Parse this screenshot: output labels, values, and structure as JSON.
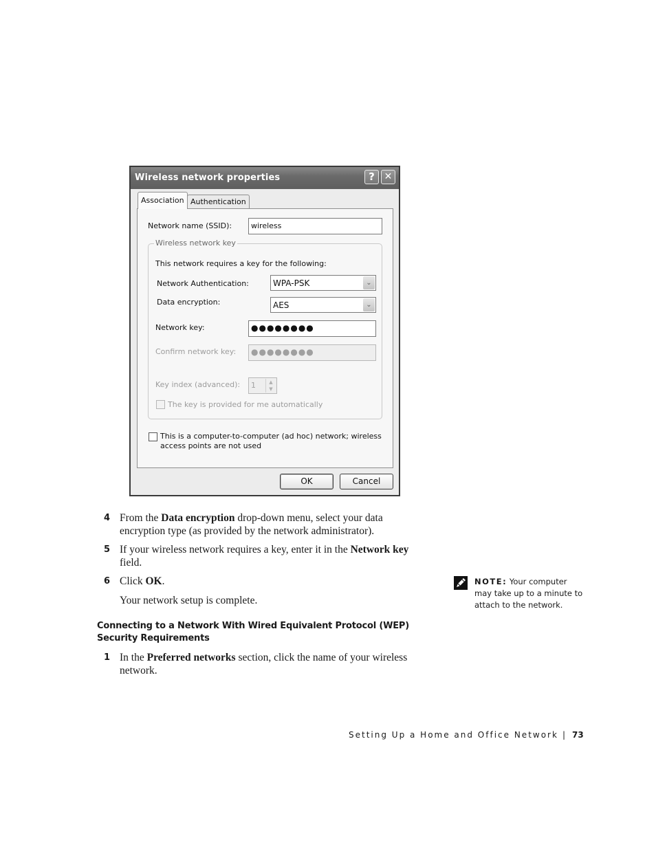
{
  "dialog": {
    "title": "Wireless network properties",
    "help_button": "?",
    "close_button": "✕",
    "tabs": [
      {
        "label": "Association",
        "active": true
      },
      {
        "label": "Authentication",
        "active": false
      }
    ],
    "ssid": {
      "label": "Network name (SSID):",
      "value": "wireless"
    },
    "key_group": {
      "legend": "Wireless network key",
      "intro": "This network requires a key for the following:",
      "network_auth": {
        "label": "Network Authentication:",
        "value": "WPA-PSK"
      },
      "data_encryption": {
        "label": "Data encryption:",
        "value": "AES"
      },
      "network_key": {
        "label": "Network key:",
        "value": "●●●●●●●●"
      },
      "confirm_key": {
        "label": "Confirm network key:",
        "value": "●●●●●●●●",
        "disabled": true
      },
      "key_index": {
        "label": "Key index (advanced):",
        "value": "1",
        "disabled": true
      },
      "auto_key": {
        "label": "The key is provided for me automatically",
        "checked": false,
        "disabled": true
      }
    },
    "adhoc": {
      "line1": "This is a computer-to-computer (ad hoc) network; wireless",
      "line2": "access points are not used",
      "checked": false
    },
    "ok_label": "OK",
    "cancel_label": "Cancel"
  },
  "steps": [
    {
      "num": "4",
      "pre": "From the ",
      "bold": "Data encryption",
      "post": " drop-down menu, select your data encryption type (as provided by the network administrator)."
    },
    {
      "num": "5",
      "pre": "If your wireless network requires a key, enter it in the ",
      "bold": "Network key",
      "post": " field."
    },
    {
      "num": "6",
      "pre": "Click ",
      "bold": "OK",
      "post": "."
    }
  ],
  "completion_text": "Your network setup is complete.",
  "note": {
    "label": "NOTE:",
    "text": " Your computer may take up to a minute to attach to the network."
  },
  "section_heading": "Connecting to a Network With Wired Equivalent Protocol (WEP) Security Requirements",
  "section_steps": [
    {
      "num": "1",
      "pre": "In the ",
      "bold": "Preferred networks",
      "post": " section, click the name of your wireless network."
    }
  ],
  "footer": {
    "chapter": "Setting Up a Home and Office Network",
    "separator": "|",
    "page": "73"
  }
}
